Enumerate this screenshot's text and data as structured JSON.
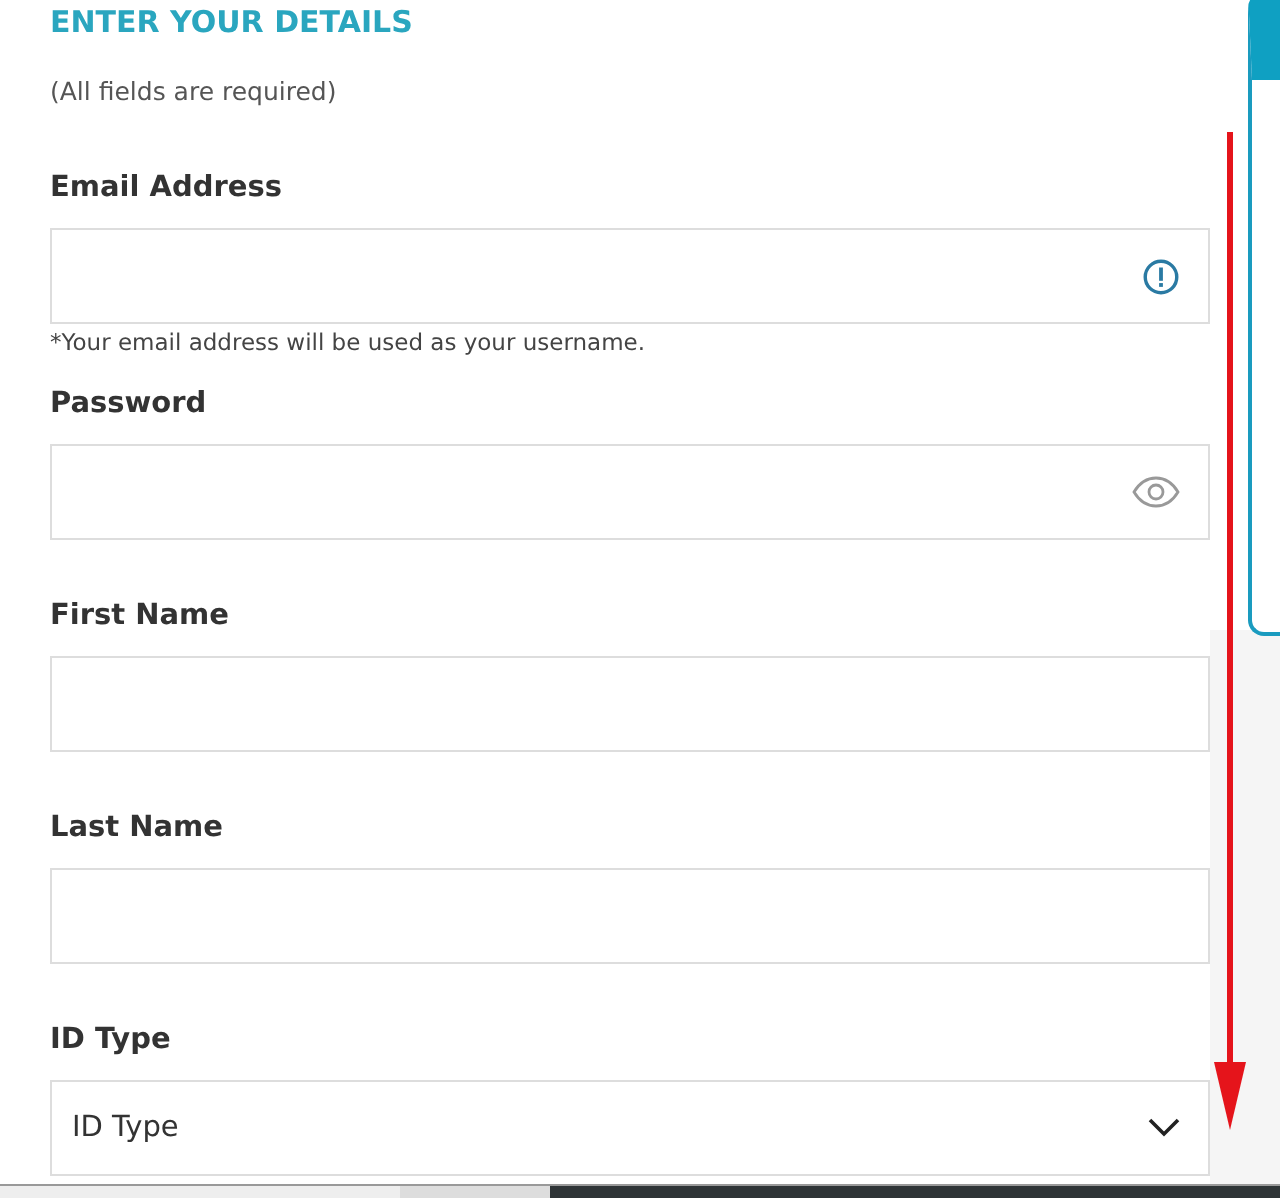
{
  "form": {
    "title": "ENTER YOUR DETAILS",
    "note": "(All fields are required)",
    "fields": [
      {
        "kind": "email",
        "label": "Email Address",
        "hint": "*Your email address will be used as your username."
      },
      {
        "kind": "password",
        "label": "Password"
      },
      {
        "kind": "text",
        "label": "First Name"
      },
      {
        "kind": "text",
        "label": "Last Name"
      },
      {
        "kind": "select",
        "label": "ID Type",
        "value": "ID Type"
      }
    ]
  }
}
